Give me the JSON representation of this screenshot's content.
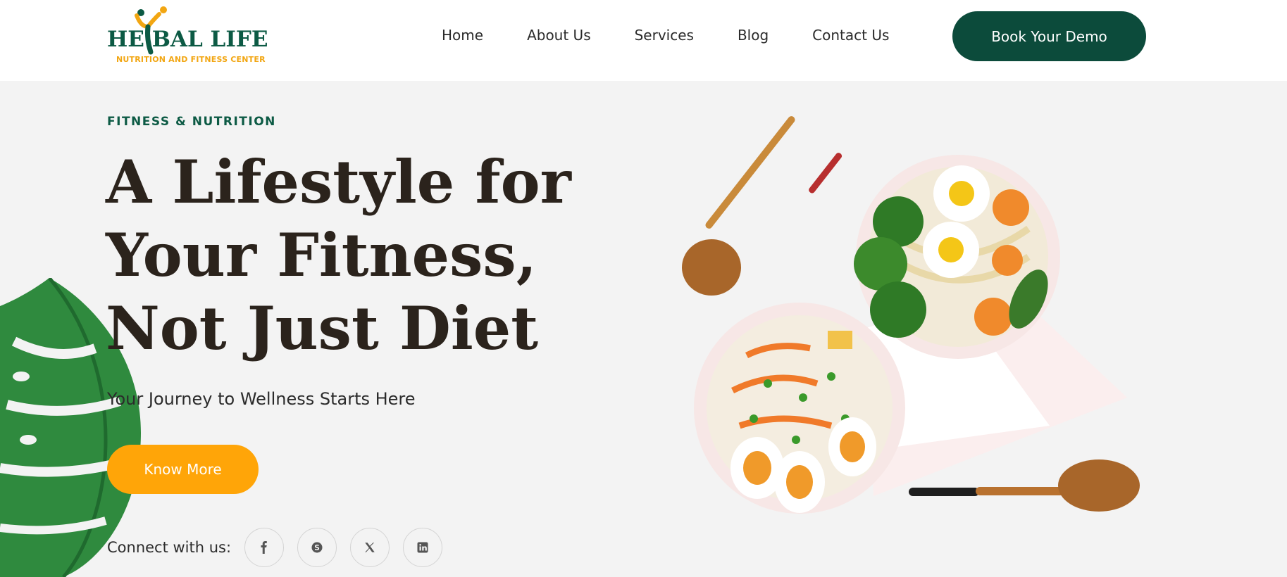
{
  "header": {
    "logo": {
      "title": "HE BAL LIFE",
      "subtitle": "NUTRITION AND FITNESS CENTER",
      "icon": "fitness-person-logo"
    },
    "nav": [
      {
        "label": "Home"
      },
      {
        "label": "About Us"
      },
      {
        "label": "Services"
      },
      {
        "label": "Blog"
      },
      {
        "label": "Contact Us"
      }
    ],
    "cta_label": "Book Your Demo"
  },
  "hero": {
    "eyebrow": "FITNESS & NUTRITION",
    "headline_lines": [
      "A Lifestyle for",
      "Your Fitness,",
      "Not Just Diet"
    ],
    "subheading": "Your Journey to Wellness Starts Here",
    "button_label": "Know More",
    "connect_label": "Connect with us:",
    "social": [
      {
        "icon": "facebook-icon"
      },
      {
        "icon": "skype-icon"
      },
      {
        "icon": "x-twitter-icon"
      },
      {
        "icon": "linkedin-icon"
      }
    ],
    "images": {
      "left": "monstera-leaf",
      "right": "bowls-of-noodles-and-fried-rice-with-wooden-spoons"
    }
  },
  "colors": {
    "brand_green": "#0c4b3b",
    "accent_orange": "#ffa508",
    "text_dark": "#2b231c",
    "hero_background": "#f3f3f3"
  }
}
